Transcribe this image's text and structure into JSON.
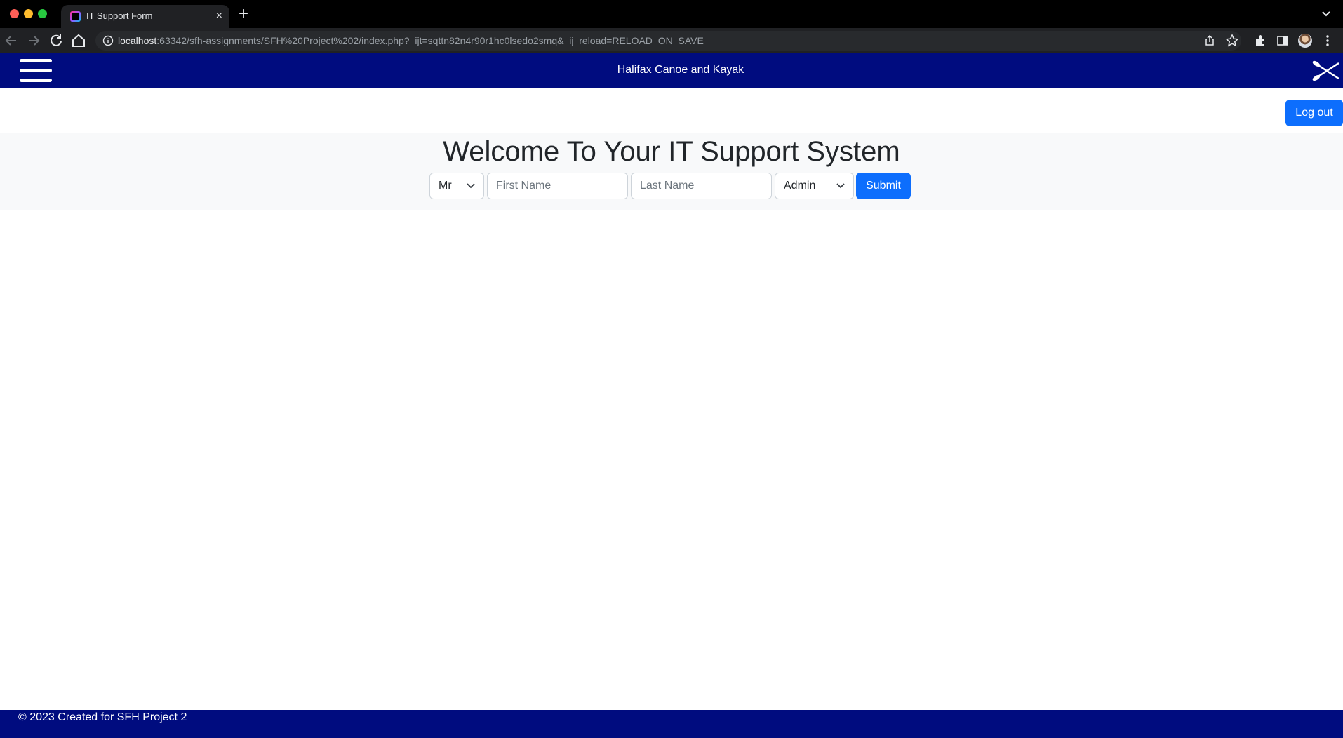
{
  "browser": {
    "tab_title": "IT Support Form",
    "tab_close": "×",
    "new_tab": "+",
    "url_host": "localhost",
    "url_rest": ":63342/sfh-assignments/SFH%20Project%202/index.php?_ijt=sqttn82n4r90r1hc0lsedo2smq&_ij_reload=RELOAD_ON_SAVE"
  },
  "header": {
    "site_title": "Halifax Canoe and Kayak",
    "menu_icon": "hamburger-icon",
    "logo_icon": "crossed-paddles-icon"
  },
  "auth": {
    "logout_label": "Log out"
  },
  "main": {
    "title": "Welcome To Your IT Support System",
    "form": {
      "salutation_value": "Mr",
      "first_name_placeholder": "First Name",
      "last_name_placeholder": "Last Name",
      "role_value": "Admin",
      "submit_label": "Submit"
    }
  },
  "footer": {
    "text": "© 2023 Created for SFH Project 2"
  },
  "colors": {
    "brand_navy": "#000c7f",
    "primary_button": "#0d6efd",
    "hero_bg": "#f8f9fa"
  }
}
